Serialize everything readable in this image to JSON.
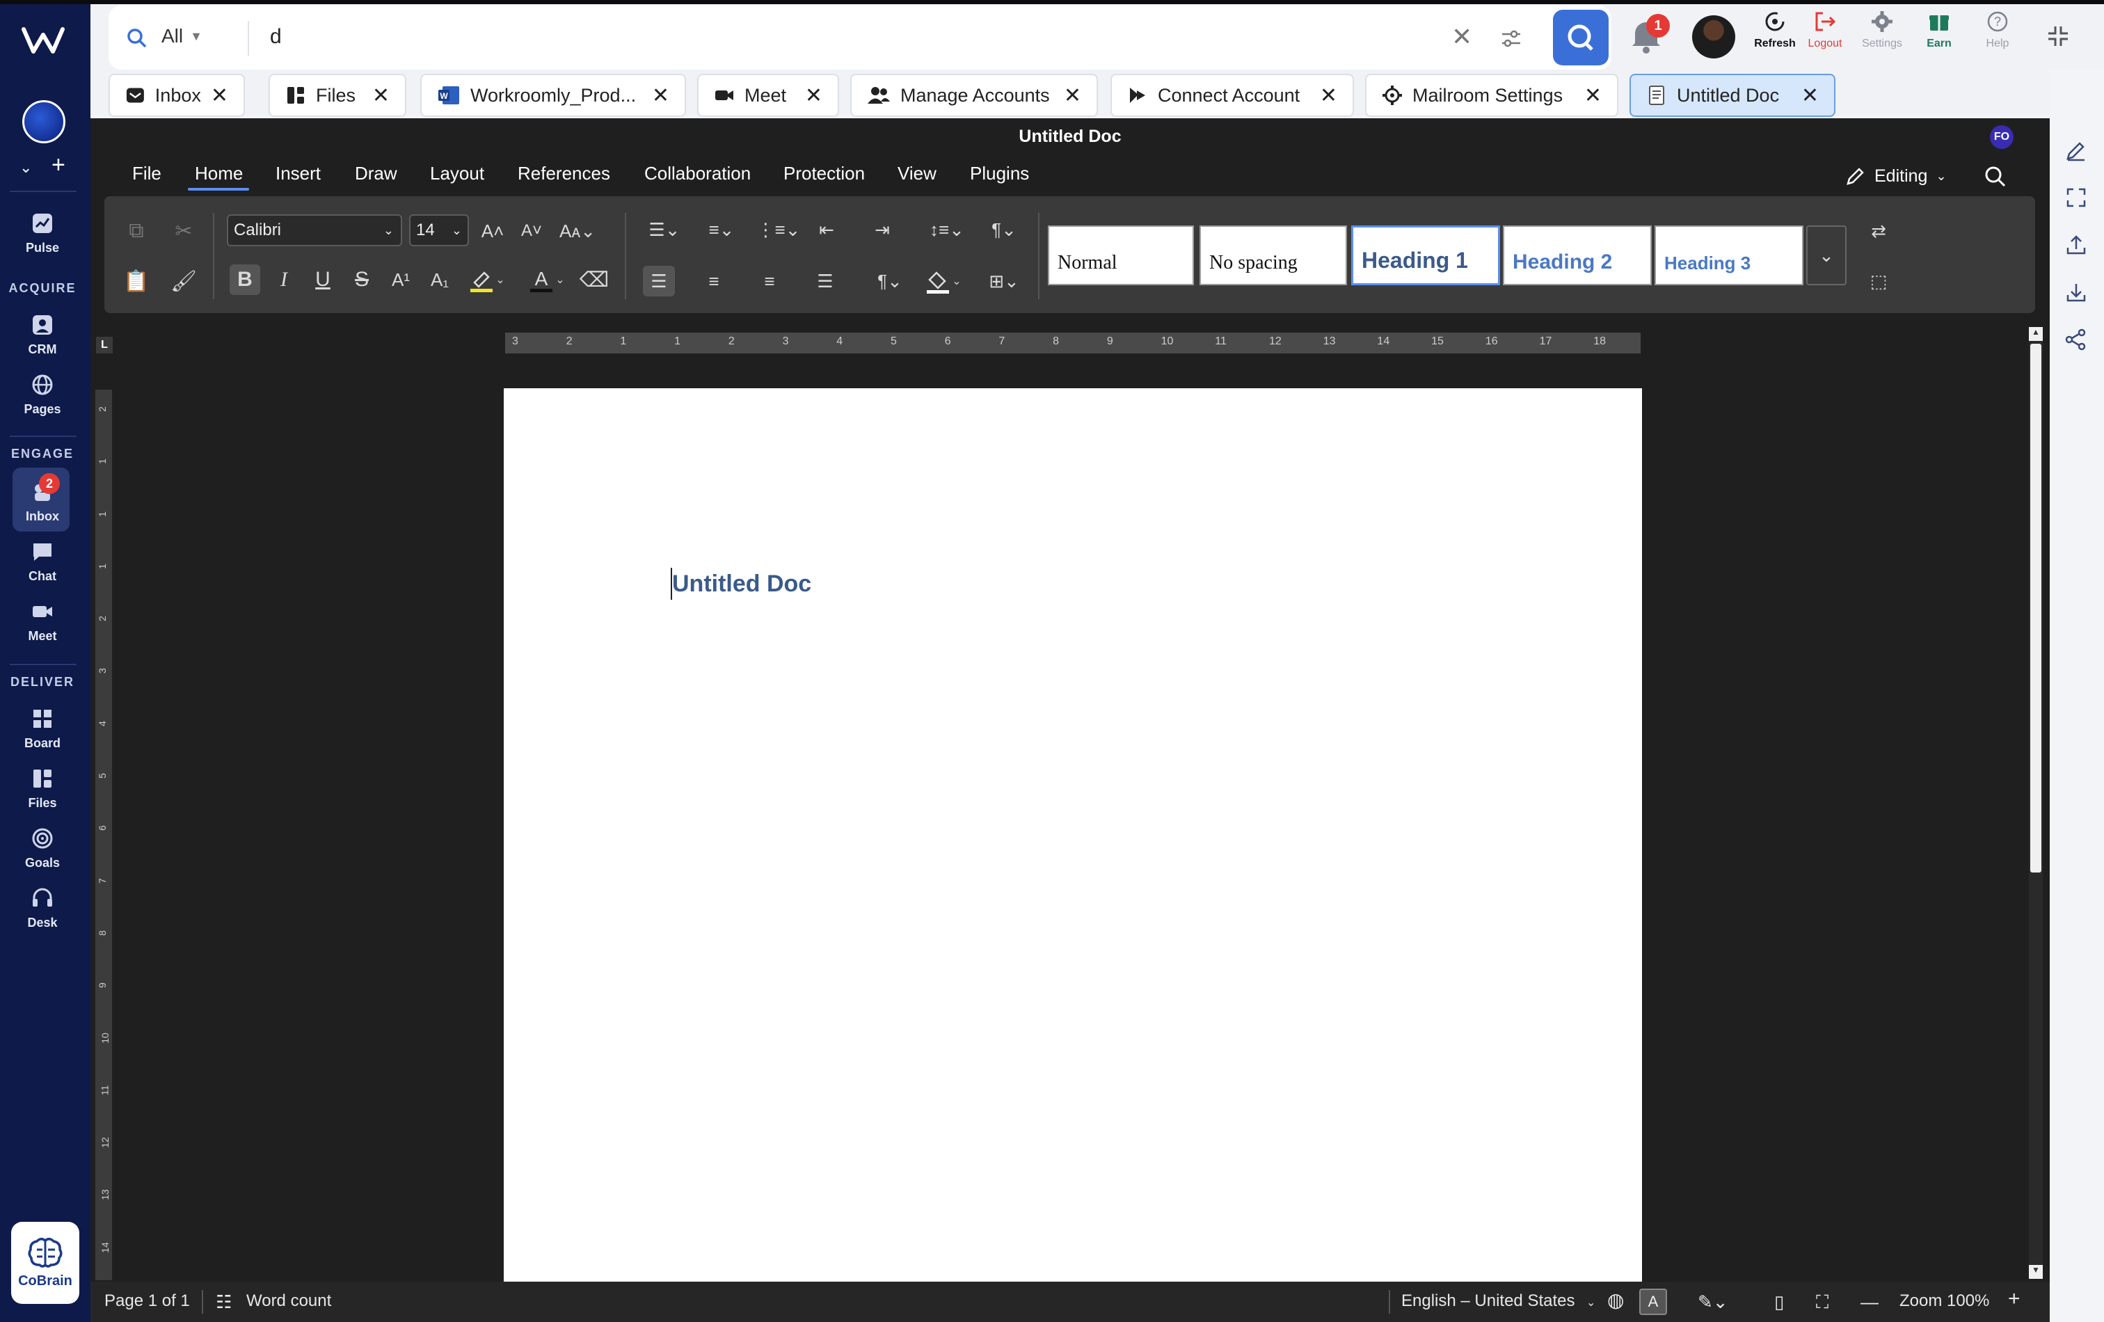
{
  "rail": {
    "pulse": "Pulse",
    "sections": {
      "acquire": "ACQUIRE",
      "engage": "ENGAGE",
      "deliver": "DELIVER"
    },
    "crm": "CRM",
    "pages": "Pages",
    "inbox": "Inbox",
    "inbox_badge": "2",
    "chat": "Chat",
    "meet": "Meet",
    "board": "Board",
    "files": "Files",
    "goals": "Goals",
    "desk": "Desk",
    "cobrain": "CoBrain"
  },
  "search": {
    "scope": "All",
    "value": "d"
  },
  "header": {
    "notifications_badge": "1",
    "refresh": "Refresh",
    "logout": "Logout",
    "settings": "Settings",
    "earn": "Earn",
    "help": "Help"
  },
  "tabs": [
    {
      "label": "Inbox"
    },
    {
      "label": "Files"
    },
    {
      "label": "Workroomly_Prod..."
    },
    {
      "label": "Meet"
    },
    {
      "label": "Manage Accounts"
    },
    {
      "label": "Connect Account"
    },
    {
      "label": "Mailroom Settings"
    },
    {
      "label": "Untitled Doc"
    }
  ],
  "editor": {
    "title": "Untitled Doc",
    "user_initials": "FO",
    "menu": [
      "File",
      "Home",
      "Insert",
      "Draw",
      "Layout",
      "References",
      "Collaboration",
      "Protection",
      "View",
      "Plugins"
    ],
    "mode": "Editing",
    "font": "Calibri",
    "font_size": "14",
    "styles": [
      "Normal",
      "No spacing",
      "Heading 1",
      "Heading 2",
      "Heading 3"
    ],
    "document_text": "Untitled Doc",
    "ruler_labels": [
      "3",
      "2",
      "1",
      "1",
      "2",
      "3",
      "4",
      "5",
      "6",
      "7",
      "8",
      "9",
      "10",
      "11",
      "12",
      "13",
      "14",
      "15",
      "16",
      "17",
      "18"
    ],
    "vruler_labels": [
      "2",
      "1",
      "1",
      "1",
      "2",
      "3",
      "4",
      "5",
      "6",
      "7",
      "8",
      "9",
      "10",
      "11",
      "12",
      "13",
      "14"
    ]
  },
  "status": {
    "page": "Page 1 of 1",
    "word_count": "Word count",
    "language": "English – United States",
    "zoom": "Zoom 100%"
  },
  "colors": {
    "rail_bg": "#0d1a4a",
    "accent": "#3b6fd8",
    "editor_bg": "#1f1f1f",
    "heading_blue": "#3a5a8a",
    "badge_red": "#e53935"
  }
}
